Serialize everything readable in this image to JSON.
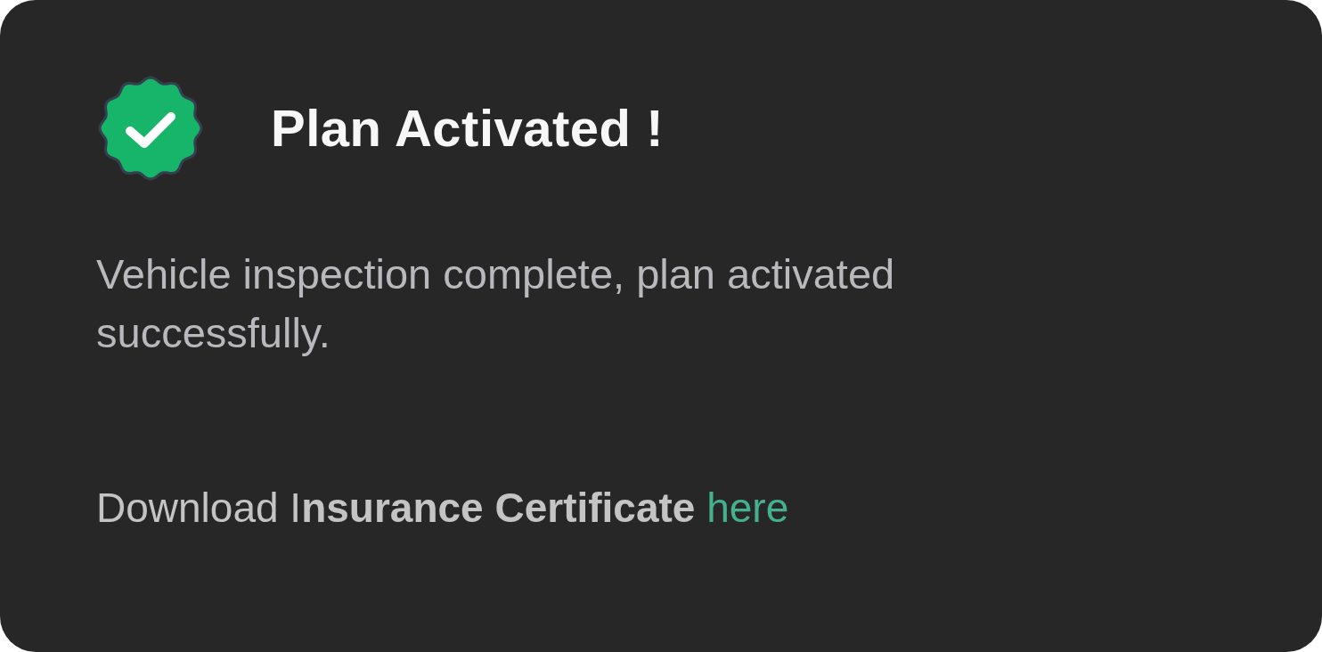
{
  "title": "Plan Activated !",
  "message": "Vehicle inspection complete, plan activated successfully.",
  "download": {
    "text": "Download I**nsurance Certificate**",
    "link": "here"
  }
}
